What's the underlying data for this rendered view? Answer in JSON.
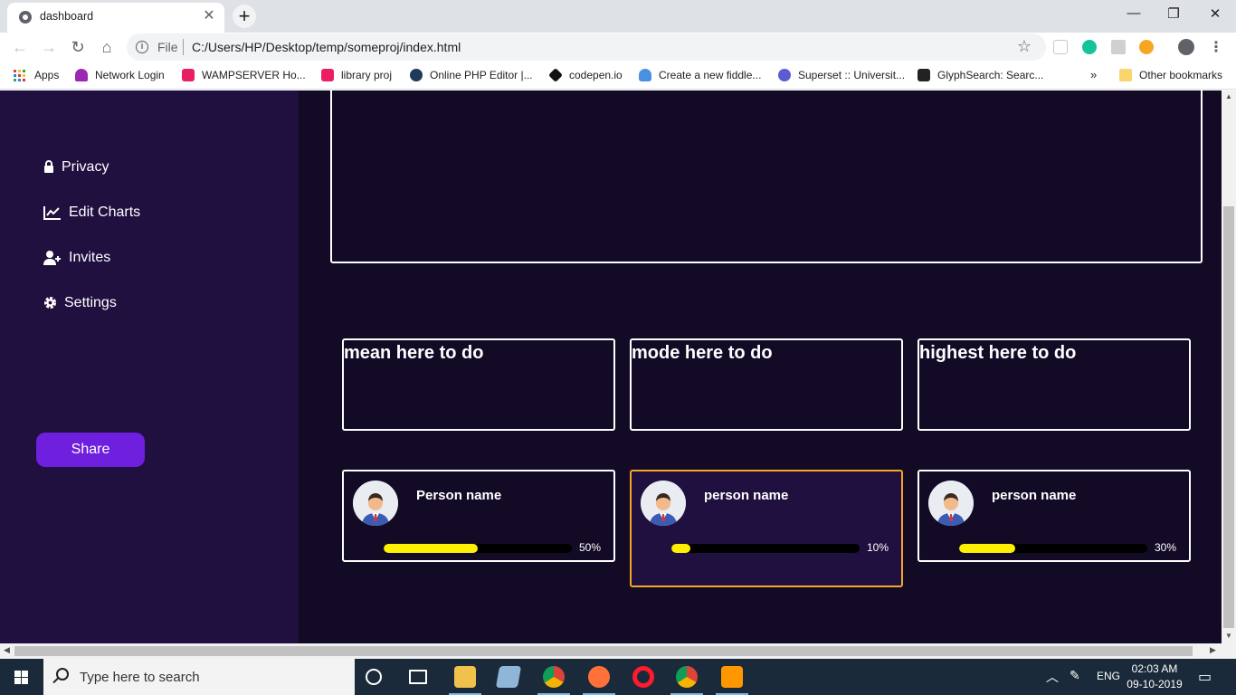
{
  "browser": {
    "tab_title": "dashboard",
    "tab_close": "✕",
    "new_tab": "+",
    "scheme_label": "File",
    "url": "C:/Users/HP/Desktop/temp/someproj/index.html",
    "bookmarks": [
      {
        "label": "Apps",
        "color": "#e53935"
      },
      {
        "label": "Network Login",
        "color": "#9c27b0"
      },
      {
        "label": "WAMPSERVER Ho...",
        "color": "#e91e63"
      },
      {
        "label": "library proj",
        "color": "#e91e63"
      },
      {
        "label": "Online PHP Editor |...",
        "color": "#1f3a5a"
      },
      {
        "label": "codepen.io",
        "color": "#111111"
      },
      {
        "label": "Create a new fiddle...",
        "color": "#4a90e2"
      },
      {
        "label": "Superset :: Universit...",
        "color": "#5b5bd6"
      },
      {
        "label": "GlyphSearch: Searc...",
        "color": "#222222"
      }
    ],
    "bookmarks_overflow": "»",
    "other_bookmarks": "Other bookmarks"
  },
  "sidebar": {
    "items": [
      {
        "label": "Privacy",
        "icon": "lock-icon"
      },
      {
        "label": "Edit Charts",
        "icon": "chart-line-icon"
      },
      {
        "label": "Invites",
        "icon": "user-plus-icon"
      },
      {
        "label": "Settings",
        "icon": "gear-icon"
      }
    ],
    "share_label": "Share"
  },
  "stats": [
    {
      "title": "mean here to do"
    },
    {
      "title": "mode here to do"
    },
    {
      "title": "highest here to do"
    }
  ],
  "people": [
    {
      "name": "Person name",
      "percent_label": "50%",
      "progress": 0.5
    },
    {
      "name": "person name",
      "percent_label": "10%",
      "progress": 0.1
    },
    {
      "name": "person name",
      "percent_label": "30%",
      "progress": 0.3
    }
  ],
  "colors": {
    "sidebar_bg": "#1f1040",
    "main_bg": "#130a26",
    "share_button": "#6f1fde",
    "progress_fill": "#ffef00",
    "active_card_border": "#f5a623"
  },
  "taskbar": {
    "search_placeholder": "Type here to search",
    "language": "ENG",
    "time": "02:03 AM",
    "date": "09-10-2019"
  }
}
